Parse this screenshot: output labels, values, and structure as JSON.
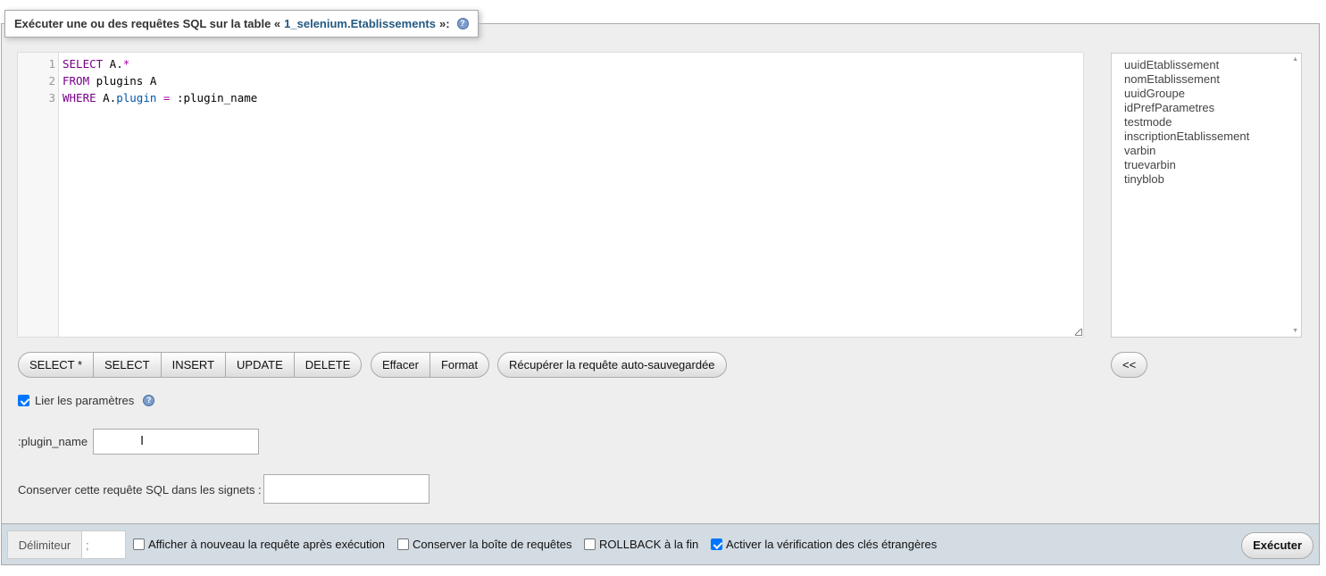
{
  "legend": {
    "prefix": "Exécuter une ou des requêtes SQL sur la table «",
    "table": "1_selenium.Etablissements",
    "suffix": "»:"
  },
  "editor": {
    "line_numbers": [
      "1",
      "2",
      "3"
    ],
    "line1": {
      "kw": "SELECT",
      "id": " A.",
      "op": "*"
    },
    "line2": {
      "kw": "FROM",
      "id": " plugins A"
    },
    "line3": {
      "kw": "WHERE",
      "id1": " A.",
      "attr": "plugin",
      "sp": " ",
      "op": "=",
      "param": " :plugin_name"
    }
  },
  "columns": [
    "uuidEtablissement",
    "nomEtablissement",
    "uuidGroupe",
    "idPrefParametres",
    "testmode",
    "inscriptionEtablissement",
    "varbin",
    "truevarbin",
    "tinyblob"
  ],
  "buttons": {
    "select_star": "SELECT *",
    "select": "SELECT",
    "insert": "INSERT",
    "update": "UPDATE",
    "delete": "DELETE",
    "clear": "Effacer",
    "format": "Format",
    "restore": "Récupérer la requête auto-sauvegardée",
    "insert_column": "<<"
  },
  "bind_params": {
    "label": "Lier les paramètres",
    "checked": true
  },
  "param": {
    "label": ":plugin_name",
    "value": ""
  },
  "bookmark": {
    "label": "Conserver cette requête SQL dans les signets :",
    "value": ""
  },
  "bottom": {
    "delimiter_label": "Délimiteur",
    "delimiter_value": ";",
    "options": [
      {
        "label": "Afficher à nouveau la requête après exécution",
        "checked": false
      },
      {
        "label": "Conserver la boîte de requêtes",
        "checked": false
      },
      {
        "label": "ROLLBACK à la fin",
        "checked": false
      },
      {
        "label": "Activer la vérification des clés étrangères",
        "checked": true
      }
    ],
    "execute": "Exécuter"
  },
  "icons": {
    "help": "help-icon"
  },
  "colors": {
    "accent": "#235a81",
    "checkbox": "#0075ff"
  }
}
